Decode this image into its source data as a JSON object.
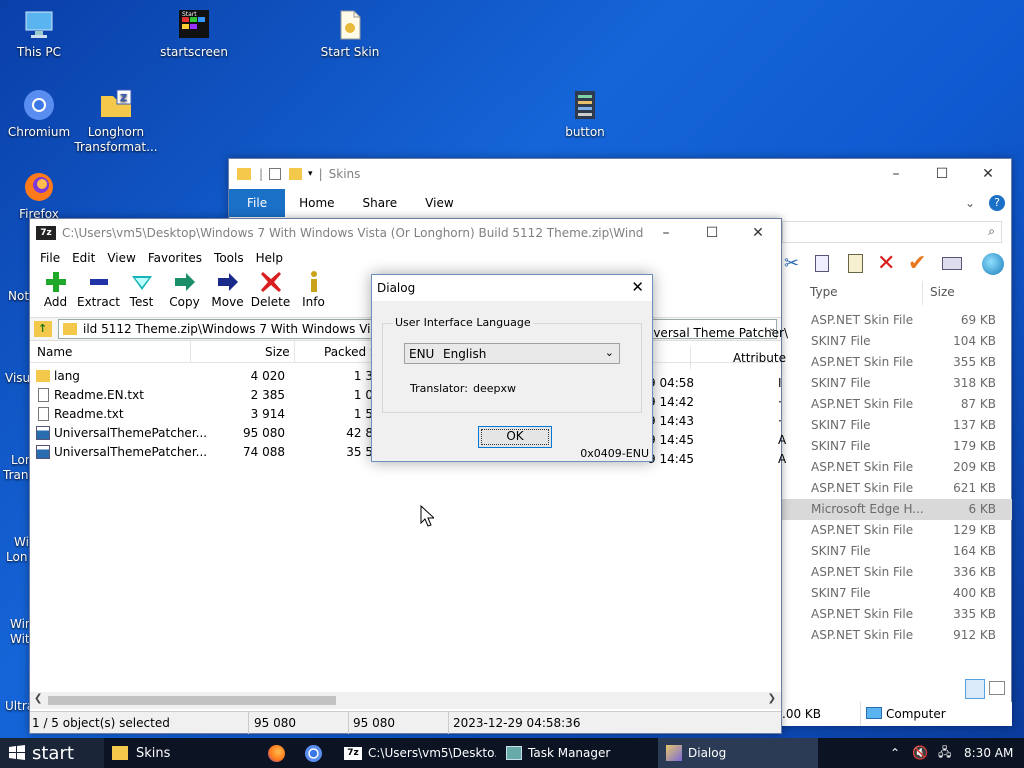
{
  "desktop": {
    "icons": [
      {
        "label": "This PC",
        "icon": "computer-icon"
      },
      {
        "label": "startscreen",
        "icon": "app-icon"
      },
      {
        "label": "Start Skin",
        "icon": "file-icon"
      },
      {
        "label": "Chromium",
        "icon": "chromium-icon"
      },
      {
        "label": "Longhorn Transformat...",
        "icon": "zip-folder-icon"
      },
      {
        "label": "button",
        "icon": "app-icon"
      },
      {
        "label": "Firefox",
        "icon": "firefox-icon"
      }
    ],
    "edge_labels": [
      "Not",
      "Visu",
      "Lon",
      "Trans",
      "Wi",
      "Lon",
      "Win",
      "Wit",
      "Ultra"
    ]
  },
  "explorer": {
    "title": "Skins",
    "tabs": [
      "File",
      "Home",
      "Share",
      "View"
    ],
    "columns": {
      "type": "Type",
      "size": "Size"
    },
    "rows": [
      {
        "type": "ASP.NET Skin File",
        "size": "69 KB"
      },
      {
        "type": "SKIN7 File",
        "size": "104 KB"
      },
      {
        "type": "ASP.NET Skin File",
        "size": "355 KB"
      },
      {
        "type": "SKIN7 File",
        "size": "318 KB"
      },
      {
        "type": "ASP.NET Skin File",
        "size": "87 KB"
      },
      {
        "type": "SKIN7 File",
        "size": "137 KB"
      },
      {
        "type": "SKIN7 File",
        "size": "179 KB"
      },
      {
        "type": "ASP.NET Skin File",
        "size": "209 KB"
      },
      {
        "type": "ASP.NET Skin File",
        "size": "621 KB"
      },
      {
        "type": "Microsoft Edge H...",
        "size": "6 KB"
      },
      {
        "type": "ASP.NET Skin File",
        "size": "129 KB"
      },
      {
        "type": "SKIN7 File",
        "size": "164 KB"
      },
      {
        "type": "ASP.NET Skin File",
        "size": "336 KB"
      },
      {
        "type": "SKIN7 File",
        "size": "400 KB"
      },
      {
        "type": "ASP.NET Skin File",
        "size": "335 KB"
      },
      {
        "type": "ASP.NET Skin File",
        "size": "912 KB"
      }
    ],
    "status_size": ".00 KB",
    "status_location": "Computer"
  },
  "sevenzip": {
    "title": "C:\\Users\\vm5\\Desktop\\Windows 7 With Windows Vista (Or Longhorn) Build 5112 Theme.zip\\Windows 7 With...",
    "menu": [
      "File",
      "Edit",
      "View",
      "Favorites",
      "Tools",
      "Help"
    ],
    "toolbar": [
      "Add",
      "Extract",
      "Test",
      "Copy",
      "Move",
      "Delete",
      "Info"
    ],
    "address": "ild 5112 Theme.zip\\Windows 7 With Windows Vista (Or",
    "address_tail": "iversal Theme Patcher\\",
    "columns": {
      "name": "Name",
      "size": "Size",
      "packed": "Packed Si",
      "attr": "Attribute"
    },
    "rows": [
      {
        "name": "lang",
        "size": "4 020",
        "packed": "1 3",
        "time": "9 04:58",
        "attr": "I"
      },
      {
        "name": "Readme.EN.txt",
        "size": "2 385",
        "packed": "1 0",
        "time": "9 14:42",
        "attr": "·"
      },
      {
        "name": "Readme.txt",
        "size": "3 914",
        "packed": "1 5",
        "time": "9 14:43",
        "attr": "·"
      },
      {
        "name": "UniversalThemePatcher...",
        "size": "95 080",
        "packed": "42 8",
        "time": "9 14:45",
        "attr": "A"
      },
      {
        "name": "UniversalThemePatcher...",
        "size": "74 088",
        "packed": "35 5",
        "time": "9 14:45",
        "attr": "A"
      }
    ],
    "status": {
      "selected": "1 / 5 object(s) selected",
      "size": "95 080",
      "packed": "95 080",
      "modified": "2023-12-29 04:58:36"
    }
  },
  "dialog": {
    "title": "Dialog",
    "group_label": "User Interface Language",
    "lang_code": "ENU",
    "lang_name": "English",
    "translator_label": "Translator:",
    "translator_name": "deepxw",
    "ok_label": "OK",
    "locale_id": "0x0409-ENU"
  },
  "taskbar": {
    "start_label": "start",
    "items": [
      "Skins",
      "C:\\Users\\vm5\\Deskto...",
      "Task Manager",
      "Dialog"
    ],
    "clock": "8:30 AM"
  },
  "colors": {
    "accent": "#1a6fc6",
    "taskbar": "#0c1424",
    "delete_red": "#d81e1e",
    "add_green": "#1fa82a"
  }
}
